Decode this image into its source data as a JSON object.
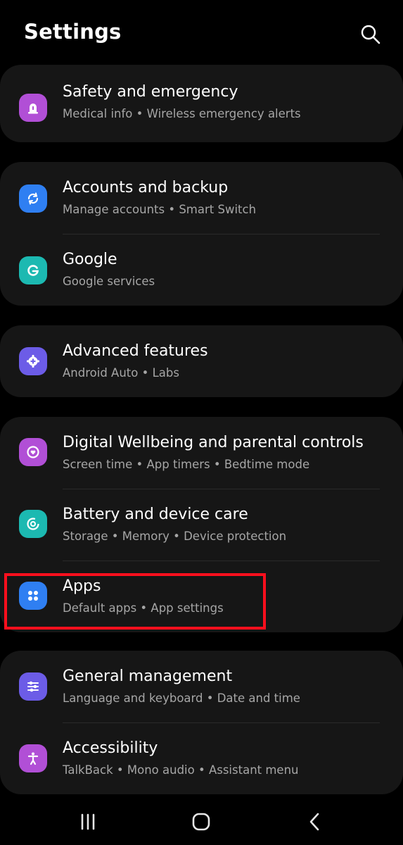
{
  "header": {
    "title": "Settings",
    "search_icon": "search-icon"
  },
  "groups": [
    {
      "items": [
        {
          "title": "Safety and emergency",
          "subtitle": "Medical info  •  Wireless emergency alerts",
          "icon": "siren-icon",
          "icon_color": "#b14fd6"
        }
      ]
    },
    {
      "items": [
        {
          "title": "Accounts and backup",
          "subtitle": "Manage accounts  •  Smart Switch",
          "icon": "sync-icon",
          "icon_color": "#2f7ff2"
        },
        {
          "title": "Google",
          "subtitle": "Google services",
          "icon": "google-icon",
          "icon_color": "#1cb9b1"
        }
      ]
    },
    {
      "items": [
        {
          "title": "Advanced features",
          "subtitle": "Android Auto  •  Labs",
          "icon": "gear-plus-icon",
          "icon_color": "#6c5ce7"
        }
      ]
    },
    {
      "items": [
        {
          "title": "Digital Wellbeing and parental controls",
          "subtitle": "Screen time  •  App timers  •  Bedtime mode",
          "icon": "heart-ring-icon",
          "icon_color": "#b14fd6"
        },
        {
          "title": "Battery and device care",
          "subtitle": "Storage  •  Memory  •  Device protection",
          "icon": "device-care-icon",
          "icon_color": "#1cb9b1"
        },
        {
          "title": "Apps",
          "subtitle": "Default apps  •  App settings",
          "icon": "apps-grid-icon",
          "icon_color": "#2f7ff2"
        }
      ]
    },
    {
      "items": [
        {
          "title": "General management",
          "subtitle": "Language and keyboard  •  Date and time",
          "icon": "sliders-icon",
          "icon_color": "#6c5ce7"
        },
        {
          "title": "Accessibility",
          "subtitle": "TalkBack  •  Mono audio  •  Assistant menu",
          "icon": "accessibility-icon",
          "icon_color": "#b14fd6"
        }
      ]
    }
  ],
  "highlight": {
    "target": "Apps",
    "color": "#ff0f1d"
  },
  "navbar": {
    "recents": "recents-icon",
    "home": "home-icon",
    "back": "back-icon"
  }
}
